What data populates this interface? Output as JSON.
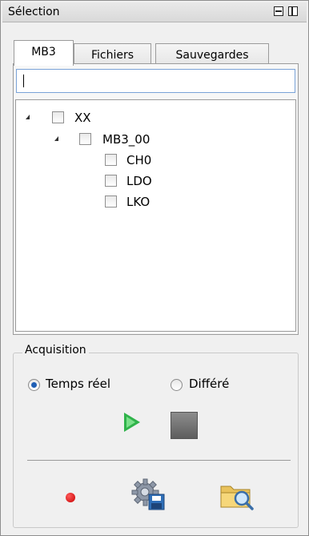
{
  "panel": {
    "title": "Sélection"
  },
  "tabs": [
    {
      "label": "MB3",
      "active": true
    },
    {
      "label": "Fichiers",
      "active": false
    },
    {
      "label": "Sauvegardes",
      "active": false
    }
  ],
  "search": {
    "value": "",
    "placeholder": ""
  },
  "tree": {
    "root": {
      "label": "XX",
      "expanded": true,
      "checked": false
    },
    "child": {
      "label": "MB3_00",
      "expanded": true,
      "checked": false
    },
    "leaves": [
      {
        "label": "CH0",
        "checked": false
      },
      {
        "label": "LDO",
        "checked": false
      },
      {
        "label": "LKO",
        "checked": false
      }
    ]
  },
  "acquisition": {
    "title": "Acquisition",
    "modes": [
      {
        "label": "Temps réel",
        "selected": true
      },
      {
        "label": "Différé",
        "selected": false
      }
    ]
  },
  "icons": [
    "minimize-icon",
    "float-icon",
    "expand-arrow-icon",
    "play-icon",
    "stop-icon",
    "record-icon",
    "settings-save-icon",
    "folder-search-icon"
  ],
  "colors": {
    "play": "#2fb34a",
    "record": "#d40000",
    "radio_selected": "#1f5fb5",
    "search_border": "#7aa3d8"
  }
}
